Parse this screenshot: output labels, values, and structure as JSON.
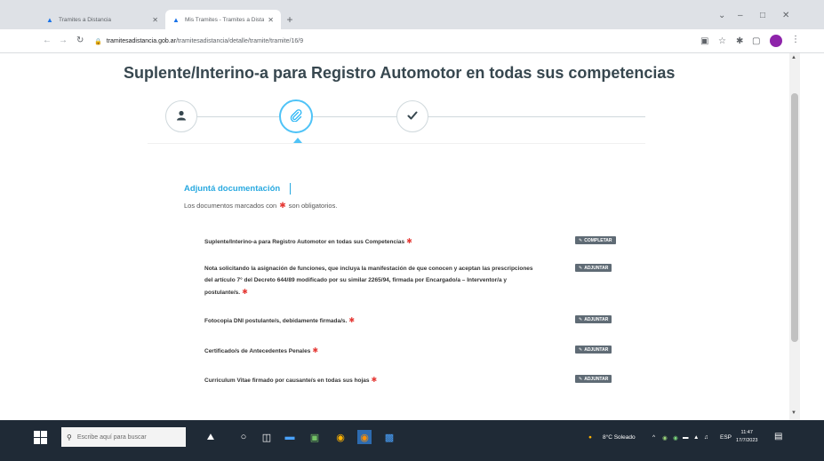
{
  "browser": {
    "tabs": [
      {
        "title": "Tramites a Distancia"
      },
      {
        "title": "Mis Tramites - Tramites a Distanc"
      }
    ],
    "new_tab_label": "+",
    "window_controls": {
      "dropdown": "⌄",
      "minimize": "–",
      "maximize": "□",
      "close": "✕"
    },
    "url_host": "tramitesadistancia.gob.ar",
    "url_path": "/tramitesadistancia/detalle/tramite/tramite/16/9",
    "nav": {
      "back": "←",
      "forward": "→",
      "reload": "↻"
    }
  },
  "page": {
    "title": "Suplente/Interino-a para Registro Automotor en todas sus competencias",
    "steps": [
      {
        "icon": "user-icon",
        "glyph": "👤"
      },
      {
        "icon": "paperclip-icon",
        "glyph": "📎"
      },
      {
        "icon": "check-icon",
        "glyph": "✔"
      }
    ],
    "section_title": "Adjuntá documentación",
    "section_note_before": "Los documentos marcados con",
    "section_note_after": "son obligatorios.",
    "required_mark": "✱",
    "documents": [
      {
        "label": "Suplente/Interino-a para Registro Automotor en todas sus Competencias",
        "button": "COMPLETAR",
        "button_icon": "pencil-icon",
        "button_glyph": "✎"
      },
      {
        "label": "Nota solicitando la asignación de funciones, que incluya la manifestación de que conocen y aceptan las prescripciones del artículo 7° del Decreto 644/89 modificado por su similar 2265/94, firmada por Encargado/a – Interventor/a y postulante/s.",
        "button": "ADJUNTAR",
        "button_icon": "paperclip-icon",
        "button_glyph": "✎"
      },
      {
        "label": "Fotocopia DNI postulante/s, debidamente firmada/s.",
        "button": "ADJUNTAR",
        "button_icon": "paperclip-icon",
        "button_glyph": "✎"
      },
      {
        "label": "Certificado/s de Antecedentes Penales",
        "button": "ADJUNTAR",
        "button_icon": "paperclip-icon",
        "button_glyph": "✎"
      },
      {
        "label": "Curriculum Vitae firmado por causante/s en todas sus hojas",
        "button": "ADJUNTAR",
        "button_icon": "paperclip-icon",
        "button_glyph": "✎"
      }
    ]
  },
  "taskbar": {
    "search_placeholder": "Escribe aquí para buscar",
    "weather": "8°C Soleado",
    "language": "ESP",
    "time": "11:47",
    "date": "17/7/2023"
  },
  "colors": {
    "accent": "#29a9e0",
    "required": "#e53935",
    "button_bg": "#5f6b75",
    "taskbar_bg": "#1f2a36"
  }
}
